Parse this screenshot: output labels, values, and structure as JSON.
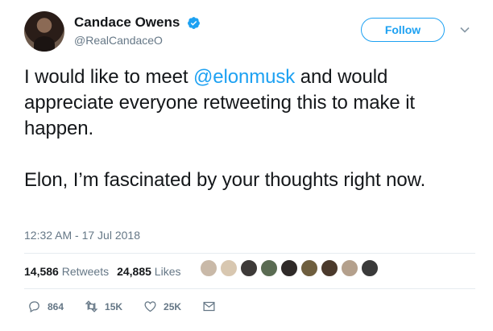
{
  "user": {
    "display_name": "Candace Owens",
    "handle": "@RealCandaceO",
    "verified": true
  },
  "follow_label": "Follow",
  "tweet": {
    "line1_before": "I would like to meet ",
    "mention": "@elonmusk",
    "line1_after": " and would appreciate everyone retweeting this to make it happen.",
    "paragraph2": "Elon, I’m fascinated by your thoughts right now."
  },
  "timestamp": "12:32 AM - 17 Jul 2018",
  "stats": {
    "retweets_count": "14,586",
    "retweets_label": "Retweets",
    "likes_count": "24,885",
    "likes_label": "Likes"
  },
  "liker_avatars": [
    "#c9b9a8",
    "#d8c7b0",
    "#3d3a38",
    "#5a6b52",
    "#2f2a28",
    "#6e5e3e",
    "#4b3a2c",
    "#b4a08c",
    "#3a3a3a"
  ],
  "actions": {
    "replies": "864",
    "retweets": "15K",
    "likes": "25K"
  },
  "colors": {
    "accent": "#1da1f2",
    "text": "#14171a",
    "muted": "#657786"
  }
}
